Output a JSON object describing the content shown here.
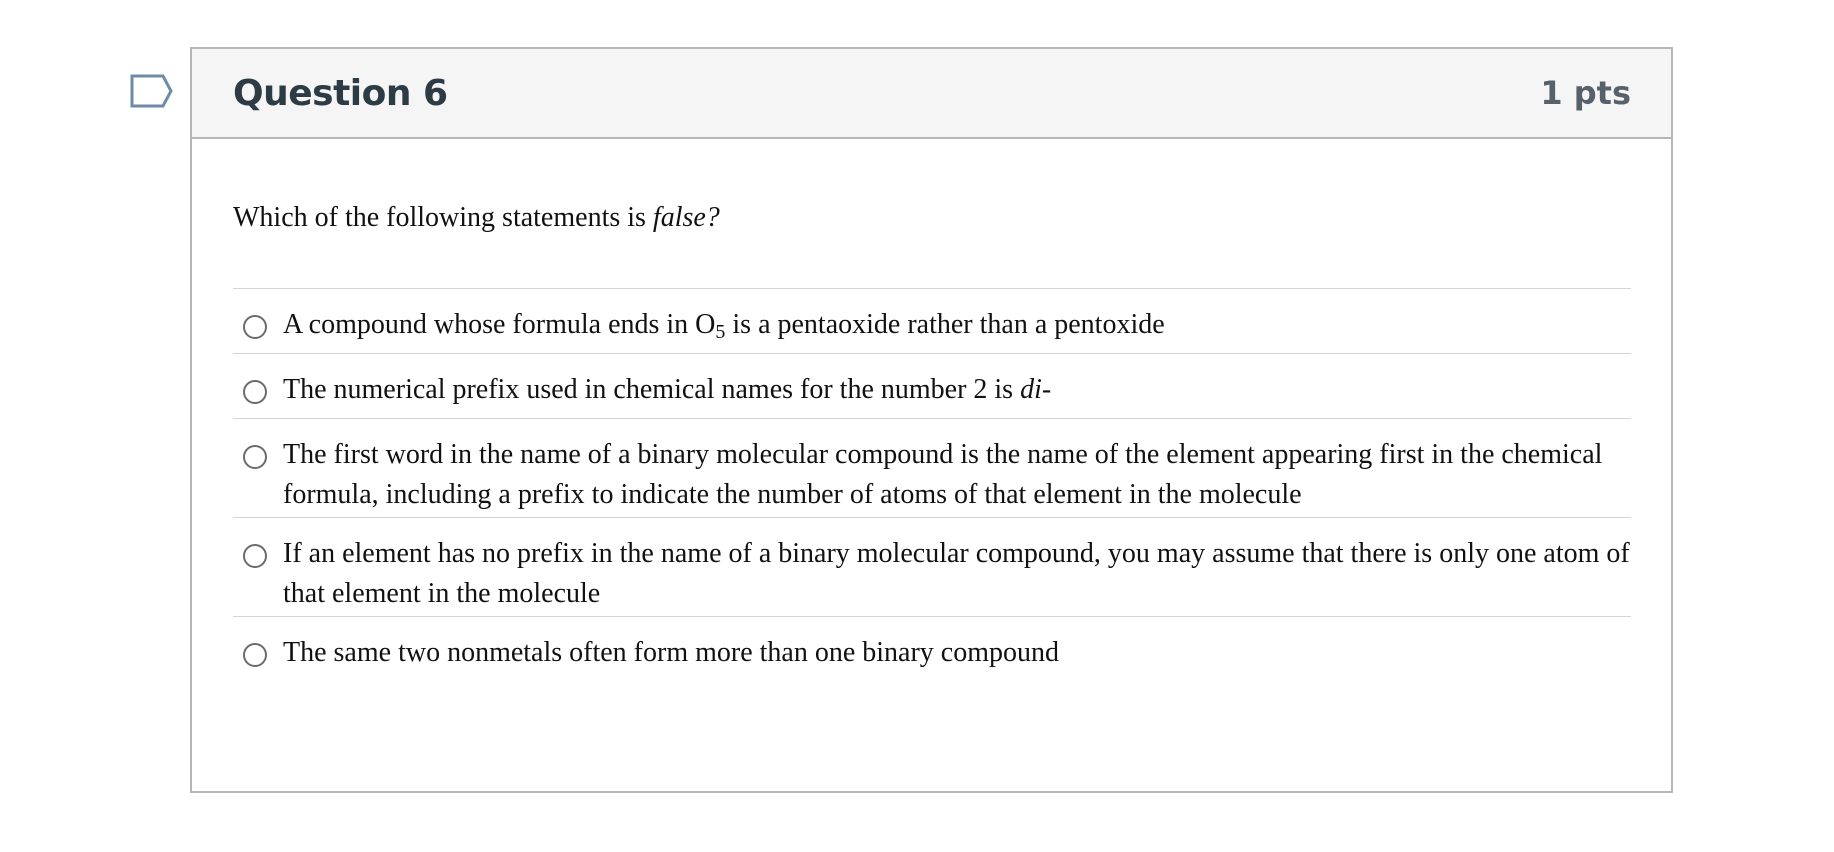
{
  "question": {
    "title": "Question 6",
    "points": "1 pts",
    "prompt_text": "Which of the following statements is ",
    "prompt_emphasis": "false?"
  },
  "answers": [
    {
      "before": "A compound whose formula ends in O",
      "sub": "5",
      "after": " is a pentaoxide rather than a pentoxide"
    },
    {
      "before": "The numerical prefix used in chemical names for the number 2 is ",
      "emphasis": "di-"
    },
    {
      "text": "The first word in the name of a binary molecular compound is the name of the element appearing first in the chemical formula, including a prefix to indicate the number of atoms of that element in the molecule"
    },
    {
      "text": "If an element has no prefix in the name of a binary molecular compound, you may assume that there is only one atom of that element in the molecule"
    },
    {
      "text": "The same two nonmetals often form more than one binary compound"
    }
  ],
  "icons": {
    "flag": "flag-question-icon",
    "radio": "radio-unchecked-icon"
  },
  "colors": {
    "header_bg": "#f5f5f5",
    "border": "#b7b7b7",
    "title": "#2d3b45",
    "flag_outline": "#6f8aa6"
  }
}
